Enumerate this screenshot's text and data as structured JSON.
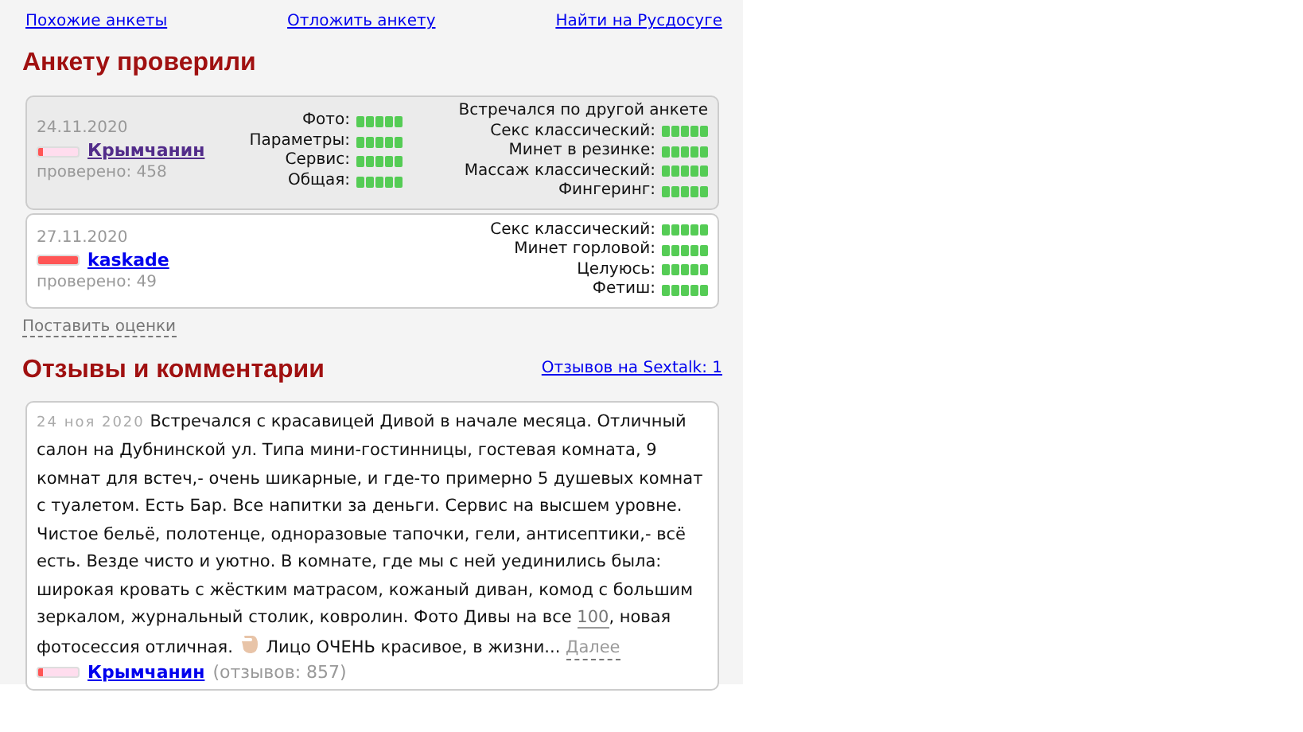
{
  "top_links": [
    {
      "label": "Похожие анкеты"
    },
    {
      "label": "Отложить анкету"
    },
    {
      "label": "Найти на Русдосуге"
    }
  ],
  "checked_section": {
    "title": "Анкету проверили",
    "checks": [
      {
        "date": "24.11.2020",
        "name": "Крымчанин",
        "level": 0.1,
        "highlighted": true,
        "checked_count": "проверено: 458",
        "main_ratings": [
          {
            "label": "Фото:",
            "stars": 5
          },
          {
            "label": "Параметры:",
            "stars": 5
          },
          {
            "label": "Сервис:",
            "stars": 5
          },
          {
            "label": "Общая:",
            "stars": 5
          }
        ],
        "note": "Встречался по другой анкете",
        "service_ratings": [
          {
            "label": "Секс классический:",
            "stars": 5
          },
          {
            "label": "Минет в резинке:",
            "stars": 5
          },
          {
            "label": "Массаж классический:",
            "stars": 5
          },
          {
            "label": "Фингеринг:",
            "stars": 5
          }
        ]
      },
      {
        "date": "27.11.2020",
        "name": "kaskade",
        "level": 1,
        "highlighted": false,
        "checked_count": "проверено: 49",
        "service_ratings": [
          {
            "label": "Секс классический:",
            "stars": 5
          },
          {
            "label": "Минет горловой:",
            "stars": 5
          },
          {
            "label": "Целуюсь:",
            "stars": 5
          },
          {
            "label": "Фетиш:",
            "stars": 5
          }
        ]
      }
    ],
    "rate_link": "Поставить оценки"
  },
  "reviews_section": {
    "title": "Отзывы и комментарии",
    "sextalk_link": "Отзывов на Sextalk: 1",
    "reviews": [
      {
        "date": "24 ноя 2020",
        "text_1": "Встречался с красавицей Дивой в начале месяца. Отличный салон на Дубнинской ул. Типа мини-гостинницы, гостевая комната, 9 комнат для встеч,- очень шикарные, и где-то примерно 5 душевых комнат с туалетом. Есть Бар. Все напитки за деньги. Сервис на высшем уровне. Чистое бельё, полотенце, одноразовые тапочки, гели, антисептики,- всё есть. Везде чисто и уютно. В комнате, где мы с ней уединились была: широкая кровать с жёстким матрасом, кожаный диван, комод с большим зеркалом, журнальный столик, ковролин. Фото Дивы на все",
        "number_link": "100",
        "text_2": ", новая фотосессия отличная.",
        "text_3": "Лицо ОЧЕНЬ красивое, в жизни...",
        "more_link": "Далее",
        "author": "Крымчанин",
        "level": 0.1,
        "review_count": "(отзывов: 857)"
      }
    ]
  }
}
